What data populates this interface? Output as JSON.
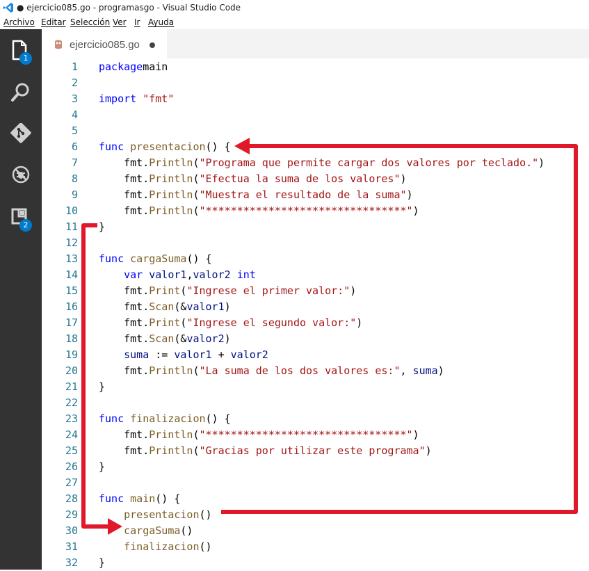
{
  "window": {
    "title": "● ejercicio085.go - programasgo - Visual Studio Code"
  },
  "menu": {
    "items": [
      "Archivo",
      "Editar",
      "Selección",
      "Ver",
      "Ir",
      "Ayuda"
    ]
  },
  "activity": {
    "items": [
      {
        "icon": "explorer-icon",
        "badge": "1"
      },
      {
        "icon": "search-icon",
        "badge": ""
      },
      {
        "icon": "git-icon",
        "badge": ""
      },
      {
        "icon": "debug-icon",
        "badge": ""
      },
      {
        "icon": "extensions-icon",
        "badge": "2"
      }
    ],
    "background": "#333333",
    "badge_color": "#007acc"
  },
  "tab": {
    "label": "ejercicio085.go",
    "dirty": true
  },
  "colors": {
    "keyword": "#0000ff",
    "string": "#a31515",
    "function": "#795e26",
    "variable": "#001080",
    "line_number": "#237893",
    "annotation": "#e0192a"
  },
  "code_lines": [
    [
      [
        "kw",
        "package"
      ],
      [
        "",
        "main"
      ]
    ],
    [],
    [
      [
        "kw",
        "import"
      ],
      [
        "",
        " "
      ],
      [
        "str",
        "\"fmt\""
      ]
    ],
    [],
    [],
    [
      [
        "kw",
        "func"
      ],
      [
        "",
        " "
      ],
      [
        "fn",
        "presentacion"
      ],
      [
        "",
        "() {"
      ]
    ],
    [
      [
        "",
        "    fmt."
      ],
      [
        "fn",
        "Println"
      ],
      [
        "",
        "("
      ],
      [
        "str",
        "\"Programa que permite cargar dos valores por teclado.\""
      ],
      [
        "",
        ")"
      ]
    ],
    [
      [
        "",
        "    fmt."
      ],
      [
        "fn",
        "Println"
      ],
      [
        "",
        "("
      ],
      [
        "str",
        "\"Efectua la suma de los valores\""
      ],
      [
        "",
        ")"
      ]
    ],
    [
      [
        "",
        "    fmt."
      ],
      [
        "fn",
        "Println"
      ],
      [
        "",
        "("
      ],
      [
        "str",
        "\"Muestra el resultado de la suma\""
      ],
      [
        "",
        ")"
      ]
    ],
    [
      [
        "",
        "    fmt."
      ],
      [
        "fn",
        "Println"
      ],
      [
        "",
        "("
      ],
      [
        "str",
        "\"********************************\""
      ],
      [
        "",
        ")"
      ]
    ],
    [
      [
        "",
        "}"
      ]
    ],
    [],
    [
      [
        "kw",
        "func"
      ],
      [
        "",
        " "
      ],
      [
        "fn",
        "cargaSuma"
      ],
      [
        "",
        "() {"
      ]
    ],
    [
      [
        "",
        "    "
      ],
      [
        "kw",
        "var"
      ],
      [
        "",
        " "
      ],
      [
        "vr",
        "valor1"
      ],
      [
        "",
        ","
      ],
      [
        "vr",
        "valor2"
      ],
      [
        "",
        " "
      ],
      [
        "kw",
        "int"
      ]
    ],
    [
      [
        "",
        "    fmt."
      ],
      [
        "fn",
        "Print"
      ],
      [
        "",
        "("
      ],
      [
        "str",
        "\"Ingrese el primer valor:\""
      ],
      [
        "",
        ")"
      ]
    ],
    [
      [
        "",
        "    fmt."
      ],
      [
        "fn",
        "Scan"
      ],
      [
        "",
        "(&"
      ],
      [
        "vr",
        "valor1"
      ],
      [
        "",
        ")"
      ]
    ],
    [
      [
        "",
        "    fmt."
      ],
      [
        "fn",
        "Print"
      ],
      [
        "",
        "("
      ],
      [
        "str",
        "\"Ingrese el segundo valor:\""
      ],
      [
        "",
        ")"
      ]
    ],
    [
      [
        "",
        "    fmt."
      ],
      [
        "fn",
        "Scan"
      ],
      [
        "",
        "(&"
      ],
      [
        "vr",
        "valor2"
      ],
      [
        "",
        ")"
      ]
    ],
    [
      [
        "",
        "    "
      ],
      [
        "vr",
        "suma"
      ],
      [
        "",
        " := "
      ],
      [
        "vr",
        "valor1"
      ],
      [
        "",
        " + "
      ],
      [
        "vr",
        "valor2"
      ]
    ],
    [
      [
        "",
        "    fmt."
      ],
      [
        "fn",
        "Println"
      ],
      [
        "",
        "("
      ],
      [
        "str",
        "\"La suma de los dos valores es:\""
      ],
      [
        "",
        ", "
      ],
      [
        "vr",
        "suma"
      ],
      [
        "",
        ")"
      ]
    ],
    [
      [
        "",
        "}"
      ]
    ],
    [],
    [
      [
        "kw",
        "func"
      ],
      [
        "",
        " "
      ],
      [
        "fn",
        "finalizacion"
      ],
      [
        "",
        "() {"
      ]
    ],
    [
      [
        "",
        "    fmt."
      ],
      [
        "fn",
        "Println"
      ],
      [
        "",
        "("
      ],
      [
        "str",
        "\"********************************\""
      ],
      [
        "",
        ")"
      ]
    ],
    [
      [
        "",
        "    fmt."
      ],
      [
        "fn",
        "Println"
      ],
      [
        "",
        "("
      ],
      [
        "str",
        "\"Gracias por utilizar este programa\""
      ],
      [
        "",
        ")"
      ]
    ],
    [
      [
        "",
        "}"
      ]
    ],
    [],
    [
      [
        "kw",
        "func"
      ],
      [
        "",
        " "
      ],
      [
        "fn",
        "main"
      ],
      [
        "",
        "() {"
      ]
    ],
    [
      [
        "",
        "    "
      ],
      [
        "fn",
        "presentacion"
      ],
      [
        "",
        "()"
      ]
    ],
    [
      [
        "",
        "    "
      ],
      [
        "fn",
        "cargaSuma"
      ],
      [
        "",
        "()"
      ]
    ],
    [
      [
        "",
        "    "
      ],
      [
        "fn",
        "finalizacion"
      ],
      [
        "",
        "()"
      ]
    ],
    [
      [
        "",
        "}"
      ]
    ]
  ]
}
